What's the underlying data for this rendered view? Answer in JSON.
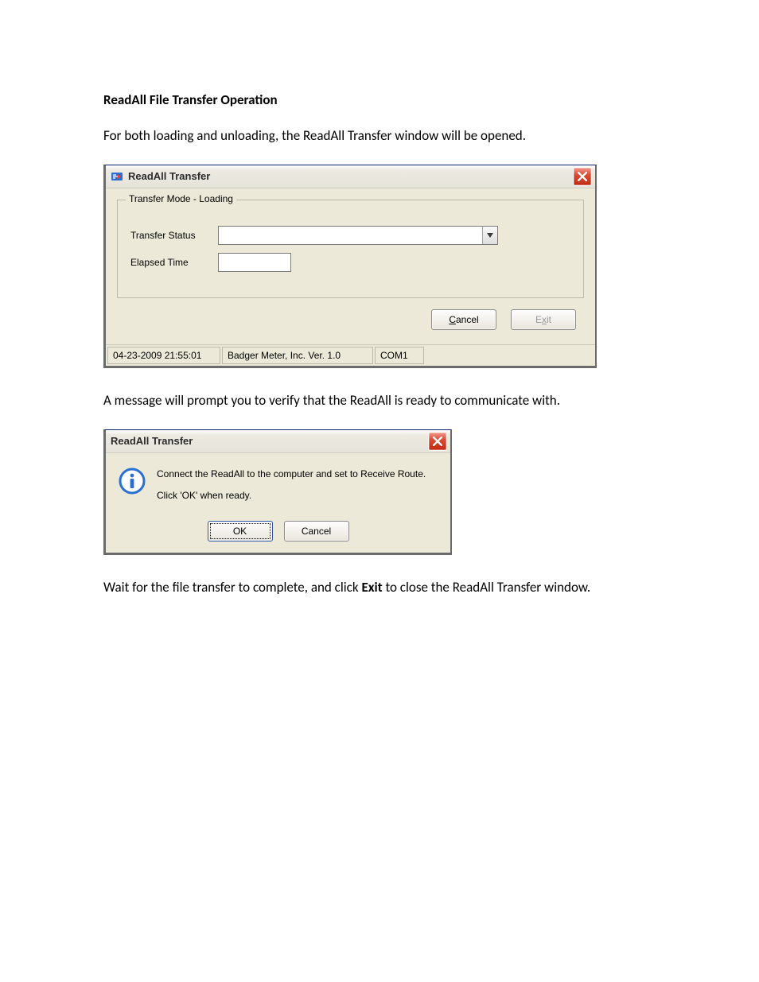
{
  "doc": {
    "heading": "ReadAll File Transfer Operation",
    "para1": "For both loading and unloading, the ReadAll Transfer window will be opened.",
    "para2": "A message will prompt you to verify that the ReadAll is ready to communicate with.",
    "para3_pre": "Wait for the file transfer to complete, and click ",
    "para3_bold": "Exit",
    "para3_post": " to close the ReadAll Transfer window."
  },
  "main_window": {
    "title": "ReadAll Transfer",
    "legend": "Transfer Mode - Loading",
    "label_status": "Transfer Status",
    "label_elapsed": "Elapsed Time",
    "combo_value": "",
    "elapsed_value": "",
    "cancel_prefix": "C",
    "cancel_rest": "ancel",
    "exit_prefix": "E",
    "exit_mid": "x",
    "exit_rest": "it",
    "status_timestamp": "04-23-2009 21:55:01",
    "status_version": "Badger Meter, Inc. Ver. 1.0",
    "status_port": "COM1"
  },
  "msg_window": {
    "title": "ReadAll Transfer",
    "line1": "Connect the ReadAll to the computer and set to Receive Route.",
    "line2": "Click 'OK' when ready.",
    "ok_label": "OK",
    "cancel_label": "Cancel"
  }
}
